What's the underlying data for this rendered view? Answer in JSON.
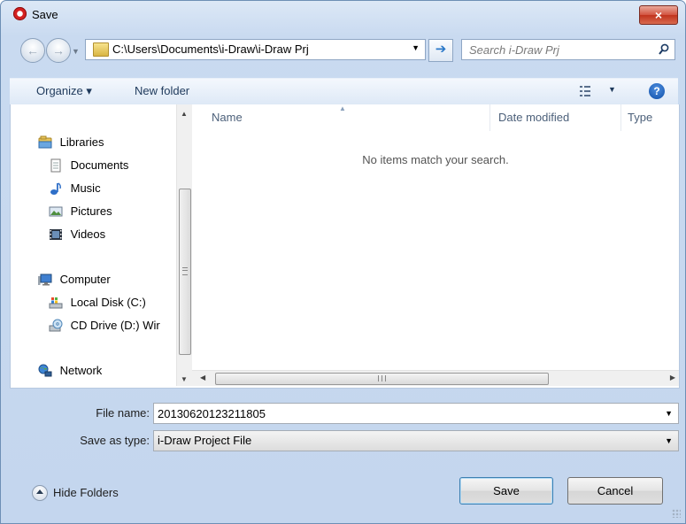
{
  "window": {
    "title": "Save",
    "close_glyph": "×"
  },
  "address_bar": {
    "back_glyph": "←",
    "forward_glyph": "→",
    "path": "C:\\Users\\Documents\\i-Draw\\i-Draw Prj",
    "go_glyph": "➔"
  },
  "search": {
    "placeholder": "Search i-Draw Prj"
  },
  "toolbar": {
    "organize": "Organize ▾",
    "new_folder": "New folder",
    "help_glyph": "?"
  },
  "nav_pane": {
    "items": [
      {
        "label": "Libraries",
        "icon": "libraries-icon"
      },
      {
        "label": "Documents",
        "icon": "documents-icon"
      },
      {
        "label": "Music",
        "icon": "music-icon"
      },
      {
        "label": "Pictures",
        "icon": "pictures-icon"
      },
      {
        "label": "Videos",
        "icon": "videos-icon"
      },
      {
        "label": "Computer",
        "icon": "computer-icon"
      },
      {
        "label": "Local Disk (C:)",
        "icon": "local-disk-icon"
      },
      {
        "label": "CD Drive (D:) Wir",
        "icon": "cd-drive-icon"
      },
      {
        "label": "Network",
        "icon": "network-icon"
      }
    ]
  },
  "file_list": {
    "columns": [
      "Name",
      "Date modified",
      "Type"
    ],
    "empty_message": "No items match your search."
  },
  "form": {
    "file_name_label": "File name:",
    "file_name_value": "20130620123211805",
    "save_type_label": "Save as type:",
    "save_type_value": "i-Draw Project File"
  },
  "footer": {
    "hide_folders": "Hide Folders",
    "save": "Save",
    "cancel": "Cancel"
  },
  "colors": {
    "window_frame": "#c4d6ee",
    "close_button": "#c1331d",
    "accent_link": "#1e395b"
  }
}
